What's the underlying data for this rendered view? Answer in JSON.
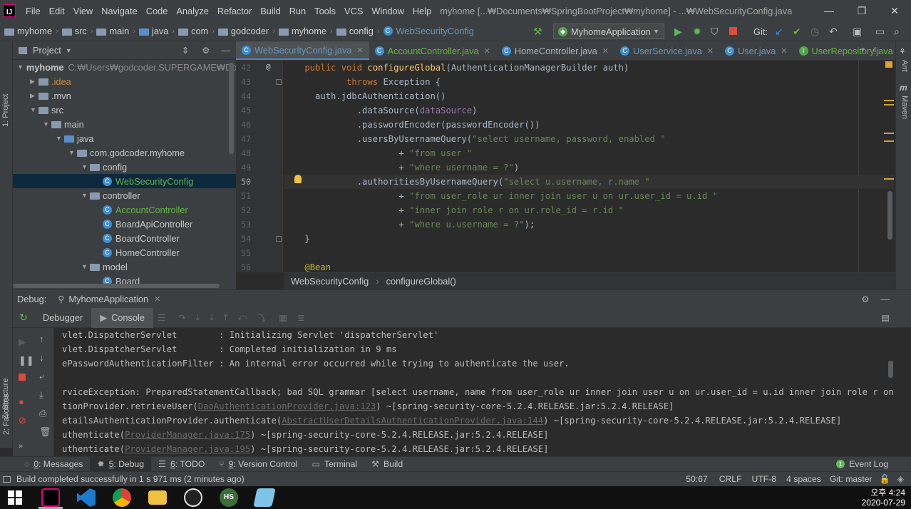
{
  "window": {
    "title": "myhome [...₩Documents₩SpringBootProject₩myhome] - ...₩WebSecurityConfig.java",
    "logo_text": "IJ",
    "menu": [
      "File",
      "Edit",
      "View",
      "Navigate",
      "Code",
      "Analyze",
      "Refactor",
      "Build",
      "Run",
      "Tools",
      "VCS",
      "Window",
      "Help"
    ]
  },
  "navbar": {
    "breadcrumbs": [
      "myhome",
      "src",
      "main",
      "java",
      "com",
      "godcoder",
      "myhome",
      "config",
      "WebSecurityConfig"
    ],
    "run_config": "MyhomeApplication",
    "git_label": "Git:"
  },
  "left_strip": {
    "project_tab": "1: Project",
    "structure_tab": "Z: Structure",
    "favorites_tab": "2: Favorites"
  },
  "right_strip": {
    "ant_tab": "Ant",
    "maven_tab": "Maven"
  },
  "project_panel": {
    "title": "Project",
    "tree": [
      {
        "label": "myhome",
        "extra": "C:₩Users₩godcoder.SUPERGAME₩Doc",
        "depth": 0,
        "kind": "folder",
        "open": true
      },
      {
        "label": ".idea",
        "depth": 1,
        "kind": "folder",
        "open": false,
        "style": "orange"
      },
      {
        "label": ".mvn",
        "depth": 1,
        "kind": "folder",
        "open": false
      },
      {
        "label": "src",
        "depth": 1,
        "kind": "folder",
        "open": true
      },
      {
        "label": "main",
        "depth": 2,
        "kind": "folder",
        "open": true
      },
      {
        "label": "java",
        "depth": 3,
        "kind": "folder-blue",
        "open": true
      },
      {
        "label": "com.godcoder.myhome",
        "depth": 4,
        "kind": "folder",
        "open": true
      },
      {
        "label": "config",
        "depth": 5,
        "kind": "folder",
        "open": true
      },
      {
        "label": "WebSecurityConfig",
        "depth": 6,
        "kind": "class",
        "selected": true,
        "style": "green"
      },
      {
        "label": "controller",
        "depth": 5,
        "kind": "folder",
        "open": true
      },
      {
        "label": "AccountController",
        "depth": 6,
        "kind": "class",
        "style": "green"
      },
      {
        "label": "BoardApiController",
        "depth": 6,
        "kind": "class"
      },
      {
        "label": "BoardController",
        "depth": 6,
        "kind": "class"
      },
      {
        "label": "HomeController",
        "depth": 6,
        "kind": "class"
      },
      {
        "label": "model",
        "depth": 5,
        "kind": "folder",
        "open": true
      },
      {
        "label": "Board",
        "depth": 6,
        "kind": "class"
      }
    ]
  },
  "editor": {
    "tabs": [
      {
        "label": "WebSecurityConfig.java",
        "active": true,
        "style": "blue"
      },
      {
        "label": "AccountController.java",
        "style": "green"
      },
      {
        "label": "HomeController.java"
      },
      {
        "label": "UserService.java",
        "style": "blue"
      },
      {
        "label": "User.java",
        "style": "blue"
      },
      {
        "label": "UserRepository.java",
        "style": "green",
        "iface": true
      }
    ],
    "tab_overflow": "4",
    "lines": [
      {
        "n": "42",
        "marker": "@",
        "tokens": [
          [
            "    ",
            ""
          ],
          [
            "public void ",
            "kw"
          ],
          [
            "configureGlobal",
            "fn"
          ],
          [
            "(AuthenticationManagerBuilder auth)",
            ""
          ]
        ]
      },
      {
        "n": "43",
        "tokens": [
          [
            "            ",
            ""
          ],
          [
            "throws ",
            "kw"
          ],
          [
            "Exception {",
            ""
          ]
        ]
      },
      {
        "n": "44",
        "tokens": [
          [
            "      auth.jdbcAuthentication()",
            ""
          ]
        ]
      },
      {
        "n": "45",
        "tokens": [
          [
            "              .dataSource(",
            ""
          ],
          [
            "dataSource",
            "pv"
          ],
          [
            ")",
            ""
          ]
        ]
      },
      {
        "n": "46",
        "tokens": [
          [
            "              .passwordEncoder(passwordEncoder())",
            ""
          ]
        ]
      },
      {
        "n": "47",
        "tokens": [
          [
            "              .usersByUsernameQuery(",
            ""
          ],
          [
            "\"select username, password, enabled \"",
            "st"
          ]
        ]
      },
      {
        "n": "48",
        "tokens": [
          [
            "                      + ",
            ""
          ],
          [
            "\"from user \"",
            "st"
          ]
        ]
      },
      {
        "n": "49",
        "tokens": [
          [
            "                      + ",
            ""
          ],
          [
            "\"where username = ?\"",
            "st"
          ],
          [
            ")",
            ""
          ]
        ]
      },
      {
        "n": "50",
        "current": true,
        "tokens": [
          [
            "              .authoritiesByUsernameQuery(",
            ""
          ],
          [
            "\"select u.username, r.name \"",
            "st"
          ]
        ]
      },
      {
        "n": "51",
        "tokens": [
          [
            "                      + ",
            ""
          ],
          [
            "\"from user_role ur inner join user u on ur.user_id = u.id \"",
            "st"
          ]
        ]
      },
      {
        "n": "52",
        "tokens": [
          [
            "                      + ",
            ""
          ],
          [
            "\"inner join role r on ur.role_id = r.id \"",
            "st"
          ]
        ]
      },
      {
        "n": "53",
        "tokens": [
          [
            "                      + ",
            ""
          ],
          [
            "\"where u.username = ?\"",
            "st"
          ],
          [
            ");",
            ""
          ]
        ]
      },
      {
        "n": "54",
        "tokens": [
          [
            "    }",
            ""
          ]
        ]
      },
      {
        "n": "55",
        "tokens": [
          [
            "",
            ""
          ]
        ]
      },
      {
        "n": "56",
        "tokens": [
          [
            "    ",
            ""
          ],
          [
            "@Bean",
            "an"
          ]
        ]
      }
    ],
    "breadcrumb": [
      "WebSecurityConfig",
      "configureGlobal()"
    ]
  },
  "debug": {
    "label": "Debug:",
    "session": "MyhomeApplication",
    "tabs": [
      "Debugger",
      "Console"
    ],
    "console": [
      {
        "parts": [
          [
            "vlet.DispatcherServlet        : Initializing Servlet 'dispatcherServlet'",
            ""
          ]
        ]
      },
      {
        "parts": [
          [
            "vlet.DispatcherServlet        : Completed initialization in 9 ms",
            ""
          ]
        ]
      },
      {
        "parts": [
          [
            "ePasswordAuthenticationFilter : An internal error occurred while trying to authenticate the user.",
            ""
          ]
        ]
      },
      {
        "parts": [
          [
            "",
            ""
          ]
        ]
      },
      {
        "parts": [
          [
            "rviceException: PreparedStatementCallback; bad SQL grammar [select username, name from user_role ur inner join user u on ur.user_id = u.id inner join role r on ur.role_id = r.",
            ""
          ]
        ]
      },
      {
        "parts": [
          [
            "tionProvider.retrieveUser(",
            ""
          ],
          [
            "DaoAuthenticationProvider.java:123",
            "link"
          ],
          [
            ") ~[spring-security-core-5.2.4.RELEASE.jar:5.2.4.RELEASE]",
            ""
          ]
        ]
      },
      {
        "parts": [
          [
            "etailsAuthenticationProvider.authenticate(",
            ""
          ],
          [
            "AbstractUserDetailsAuthenticationProvider.java:144",
            "link"
          ],
          [
            ") ~[spring-security-core-5.2.4.RELEASE.jar:5.2.4.RELEASE]",
            ""
          ]
        ]
      },
      {
        "parts": [
          [
            "uthenticate(",
            ""
          ],
          [
            "ProviderManager.java:175",
            "link"
          ],
          [
            ") ~[spring-security-core-5.2.4.RELEASE.jar:5.2.4.RELEASE]",
            ""
          ]
        ]
      },
      {
        "parts": [
          [
            "uthenticate(",
            ""
          ],
          [
            "ProviderManager.java:195",
            "link"
          ],
          [
            ") ~[spring-security-core-5.2.4.RELEASE.jar:5.2.4.RELEASE]",
            ""
          ]
        ]
      }
    ]
  },
  "tool_windows": [
    {
      "key": "0",
      "label": ": Messages"
    },
    {
      "key": "5",
      "label": ": Debug",
      "active": true
    },
    {
      "key": "6",
      "label": ": TODO"
    },
    {
      "key": "9",
      "label": ": Version Control"
    },
    {
      "key": "",
      "label": "Terminal"
    },
    {
      "key": "",
      "label": "Build"
    }
  ],
  "event_log": {
    "count": "1",
    "label": "Event Log"
  },
  "status": {
    "message": "Build completed successfully in 1 s 971 ms (2 minutes ago)",
    "position": "50:67",
    "line_sep": "CRLF",
    "encoding": "UTF-8",
    "indent": "4 spaces",
    "git_branch": "Git: master"
  },
  "taskbar": {
    "time": "오후 4:24",
    "date": "2020-07-29",
    "apps": [
      "windows-start",
      "intellij",
      "vscode",
      "chrome",
      "file-explorer",
      "obs",
      "hs-app",
      "notepad"
    ]
  },
  "colors": {
    "accent": "#4a88c7",
    "selection": "#0d293e",
    "string": "#6a8759",
    "keyword": "#cc7832"
  }
}
